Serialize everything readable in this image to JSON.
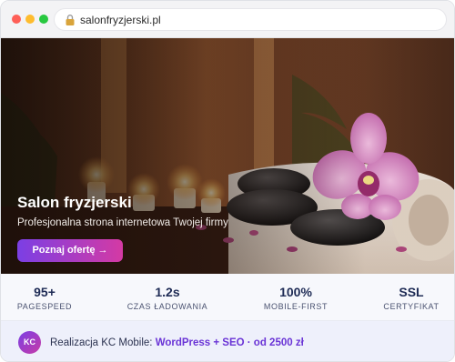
{
  "browser": {
    "url": "salonfryzjerski.pl",
    "icons": {
      "lock": "lock-icon"
    }
  },
  "hero": {
    "title": "Salon fryzjerski",
    "subtitle": "Profesjonalna strona internetowa Twojej firmy",
    "cta_label": "Poznaj ofertę →",
    "image": "spa-stones-orchid-candles-photo"
  },
  "stats": [
    {
      "value": "95+",
      "label": "PAGESPEED"
    },
    {
      "value": "1.2s",
      "label": "CZAS ŁADOWANIA"
    },
    {
      "value": "100%",
      "label": "MOBILE-FIRST"
    },
    {
      "value": "SSL",
      "label": "CERTYFIKAT"
    }
  ],
  "footer": {
    "avatar_initials": "KC",
    "text_prefix": "Realizacja KC Mobile: ",
    "text_highlight": "WordPress + SEO · od 2500 zł"
  },
  "colors": {
    "accent_purple": "#7b3fe4",
    "accent_pink": "#d43aa4",
    "stat_text": "#1e2b55"
  }
}
